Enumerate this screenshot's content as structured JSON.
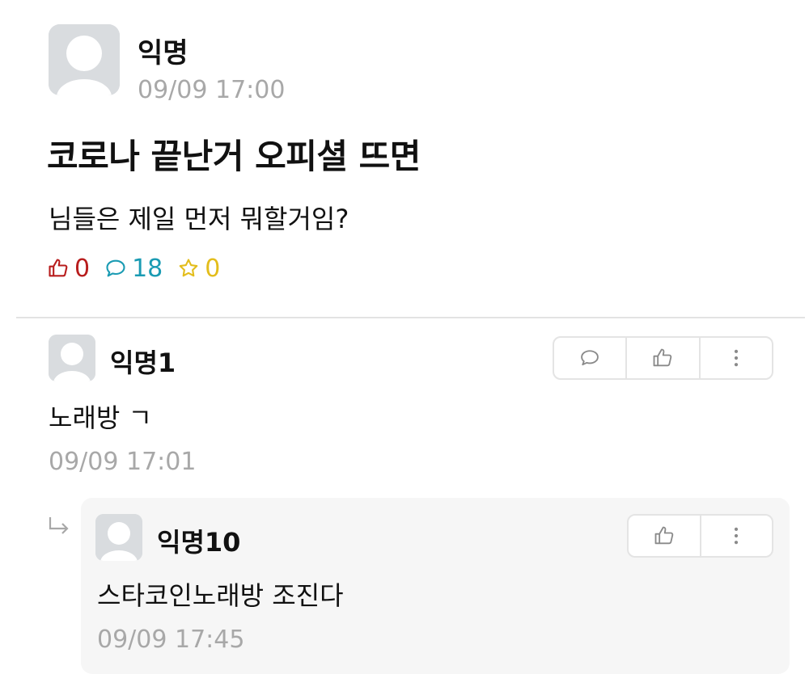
{
  "post": {
    "author": "익명",
    "time": "09/09 17:00",
    "title": "코로나 끝난거 오피셜 뜨면",
    "body": "님들은 제일 먼저 뭐할거임?",
    "stats": {
      "likes": "0",
      "comments": "18",
      "scraps": "0"
    }
  },
  "comments": [
    {
      "author": "익명1",
      "text": "노래방 ㄱ",
      "time": "09/09 17:01",
      "actions": [
        "comment-icon",
        "thumbs-up-icon",
        "more-icon"
      ]
    }
  ],
  "reply": {
    "author": "익명10",
    "text": "스타코인노래방 조진다",
    "time": "09/09 17:45",
    "actions": [
      "thumbs-up-icon",
      "more-icon"
    ]
  },
  "colors": {
    "like": "#b81d1d",
    "comment": "#1a9bb3",
    "scrap": "#e3bd1b",
    "muted_text": "#a8a8a8",
    "avatar_bg": "#d9dcdf",
    "reply_bg": "#f6f6f6"
  }
}
